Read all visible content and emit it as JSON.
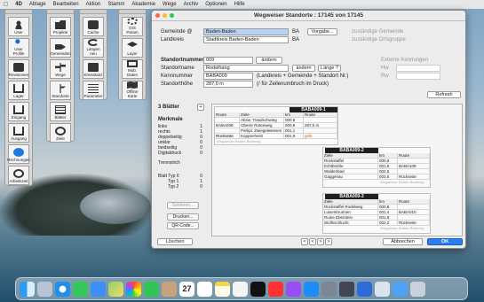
{
  "menubar": {
    "apple": "",
    "app": "4D",
    "items": [
      "Ablage",
      "Bearbeiten",
      "Aktion",
      "Stamm",
      "Akademie",
      "Wege",
      "Archiv",
      "Optionen",
      "Hilfe"
    ]
  },
  "palette1": {
    "tiles": [
      "User",
      "User Profile",
      "Revisionen",
      "Lager",
      "Eingang",
      "Ausgang",
      "Rechnungen",
      "Arbeitszeit"
    ]
  },
  "palette2": {
    "tiles": [
      "Projekte",
      "Gemeinden",
      "Wege",
      "Standorte",
      "Blätter",
      "Ziele"
    ]
  },
  "palette3": {
    "tiles": [
      "Cache",
      "Längen neu",
      "Kreisstanz",
      "Parameter"
    ]
  },
  "palette4": {
    "tiles": [
      "GIS Param",
      "Layer",
      "Mob. Daten",
      "Offline Karte"
    ]
  },
  "dialog": {
    "title": "Wegweiser Standorte : 17145 von 17145",
    "gemeinde_label": "Gemeinde @",
    "gemeinde_value": "Baden-Baden",
    "gemeinde_code": "BA",
    "vorgabe_button": "Vorgabe...",
    "landkreis_label": "Landkreis",
    "landkreis_value": "Stadtkreis Baden-Baden",
    "landkreis_code": "BA",
    "zust_gemeinde": "zuständige Gemeinde",
    "zust_ortsgruppe": "zuständige Ortsgruppe",
    "standortnummer_label": "Standortnummer",
    "standortnummer_value": "009",
    "andern_button1": "ändern",
    "standortname_label": "Standortname",
    "standortname_value": "Rodelhang",
    "andern_button2": "ändern",
    "lange_button": "Länge ?",
    "kennnummer_label": "Kennnummer",
    "kennnummer_value": "BABA009",
    "kennnummer_hint": "(Landkreis + Gemeinde + Standort Nr.)",
    "standorthohe_label": "Standorthöhe",
    "standorthohe_value": "287,0 m",
    "standorthohe_hint": "(/ für Zeilenumbruch im Druck)",
    "externe": "Externe Kennungen",
    "hw": "Hw",
    "rw": "Rw",
    "refresh_button": "Refresh",
    "blatter_count": "3 Blätter",
    "merkmale_label": "Merkmale",
    "merkmale": [
      "links",
      "rechts",
      "doppelseitig",
      "unklar",
      "beidseitig",
      "Digitaldruck"
    ],
    "merkmale_counts": [
      "1",
      "1",
      "0",
      "0",
      "0",
      "0"
    ],
    "trennstrich": "Trennstrich",
    "blatt_typen": [
      "Blatt Typ 0",
      "Typ 1",
      "Typ 2"
    ],
    "blatt_counts": [
      "0",
      "1",
      "0"
    ],
    "sortieren_button": "Sortieren...",
    "drucken_button": "Drucken...",
    "qrcode_button": "QR-Code...",
    "loschen_button": "Löschen",
    "abbrechen_button": "Abbrechen",
    "ok_button": "OK",
    "nav_buttons": [
      "<",
      "<",
      "|",
      "1",
      "1",
      "|",
      ">",
      ">"
    ]
  },
  "stations": [
    {
      "header": "BABA009-1",
      "cols": [
        "Route",
        "Ziele",
        "km",
        "Route"
      ],
      "rows": [
        [
          "",
          "Abzw. Trasdschwieg",
          "000,9",
          ""
        ],
        [
          "BABA008",
          "Oberer Rotenweg",
          "000,8",
          "287,0 m"
        ],
        [
          "",
          "Parkpl. Zwiegelweesen",
          "001,1",
          ""
        ],
        [
          "Rückseite",
          "Kuppenheim",
          "001,9",
          ""
        ]
      ],
      "gelb": "gelb",
      "rueckseite": "Rückseite",
      "footer": "Wegweiser Baden-Baden/ig"
    },
    {
      "header": "BABA009-2",
      "cols": [
        "Ziele",
        "km",
        "Route"
      ],
      "rows": [
        [
          "Rückstaffel",
          "000,8",
          ""
        ],
        [
          "Echtbrühle",
          "001,6",
          "BABA108"
        ],
        [
          "Waldenbad",
          "002,6",
          ""
        ],
        [
          "Gaggenau",
          "003,5",
          "Rückseite"
        ]
      ],
      "gelb": "gelb",
      "footer": "Wegweiser Baden-Baden/ig"
    },
    {
      "header": "BABA009-3",
      "cols": [
        "Ziele",
        "km",
        "Route"
      ],
      "rows": [
        [
          "Rückstaffel Rodelweg",
          "000,8",
          ""
        ],
        [
          "Luisenbrunnen",
          "001,4",
          "BABA010"
        ],
        [
          "Ruine Eberstein",
          "001,8",
          ""
        ],
        [
          "Wolfsschlucht",
          "002,2",
          "Rückseite"
        ]
      ],
      "gelb": "gelb",
      "footer": "Wegweiser Baden-Baden/ig"
    }
  ],
  "dock": {
    "icons": [
      "finder-icon",
      "launchpad-icon",
      "safari-icon",
      "messages-icon",
      "mail-icon",
      "maps-icon",
      "photos-icon",
      "facetime-icon",
      "contacts-icon",
      "calendar-icon",
      "reminders-icon",
      "notes-icon",
      "music-icon",
      "tv-icon",
      "podcasts-icon",
      "news-icon",
      "appstore-icon",
      "settings-icon",
      "4d-icon",
      "xcode-icon",
      "preview-icon",
      "downloads-icon",
      "trash-icon"
    ],
    "calendar_day": "27"
  }
}
